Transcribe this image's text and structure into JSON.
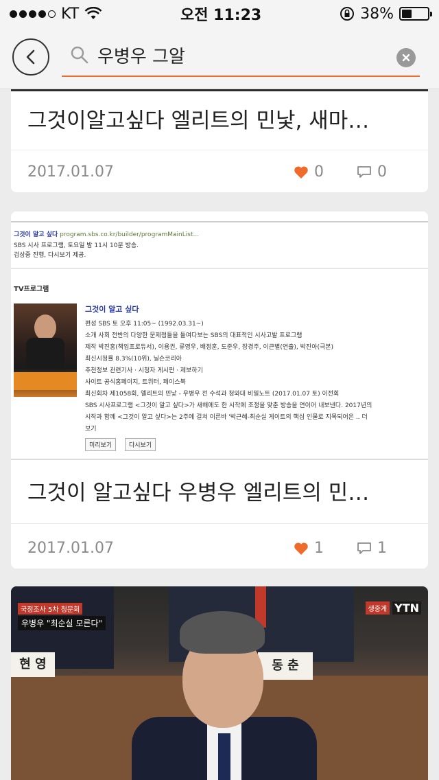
{
  "status": {
    "carrier": "KT",
    "time": "오전 11:23",
    "battery": "38%",
    "battery_level": 0.38
  },
  "search": {
    "query": "우병우 그알"
  },
  "results": [
    {
      "title": "그것이알고싶다 엘리트의 민낯, 새마…",
      "date": "2017.01.07",
      "likes": "0",
      "comments": "0"
    },
    {
      "title": "그것이 알고싶다 우병우 엘리트의 민…",
      "date": "2017.01.07",
      "likes": "1",
      "comments": "1",
      "thumbnail": {
        "link_title": "그것이 알고 싶다",
        "url": "program.sbs.co.kr/builder/programMainList...",
        "desc1": "SBS 시사 프로그램, 토요일 밤 11시 10분 방송.",
        "desc2": "검상중 진행, 다시보기 제공.",
        "section": "TV프로그램",
        "program_title": "그것이 알고 싶다",
        "rows": [
          "편성  SBS 토 오후 11:05~ (1992.03.31~)",
          "소개  사회 전반의 다양한 문제점들을 들여다보는 SBS의 대표적인 시사고발 프로그램",
          "제작  박진홍(책임프로듀서), 이용권, 류영우, 배정훈, 도준우, 장경주, 이큰별(연출), 박진아(극본)",
          "최신시청률  8.3%(10위), 닐슨코리아",
          "추천정보  관련기사 · 시청자 게시판 · 제보하기",
          "사이트  공식홈페이지, 트위터, 페이스북",
          "최신회차  제1058회, 엘리트의 민낯 - 우병우 전 수석과 청와대 비밀노트 (2017.01.07 토) 이전회",
          "SBS 시사프로그램 <그것이 알고 싶다>가 새해에도 한 시작에 조정을 맞춘 방송을 연이어 내보낸다. 2017년의",
          "시작과 함께 <그것이 알고 싶다>는 2주에 걸쳐 이른바 '박근혜-최순실 게이트의 핵심 인물로 지목되어온 .. 더",
          "보기"
        ],
        "btn1": "미리보기",
        "btn2": "다시보기"
      }
    },
    {
      "photo": {
        "caption_tag": "국정조사 5차 청문회",
        "caption_main": "우병우 \"최순실 모른다\"",
        "live": "생중계",
        "logo": "YTN",
        "nameplate_left": "현 영",
        "nameplate_right": "동 춘"
      }
    }
  ]
}
